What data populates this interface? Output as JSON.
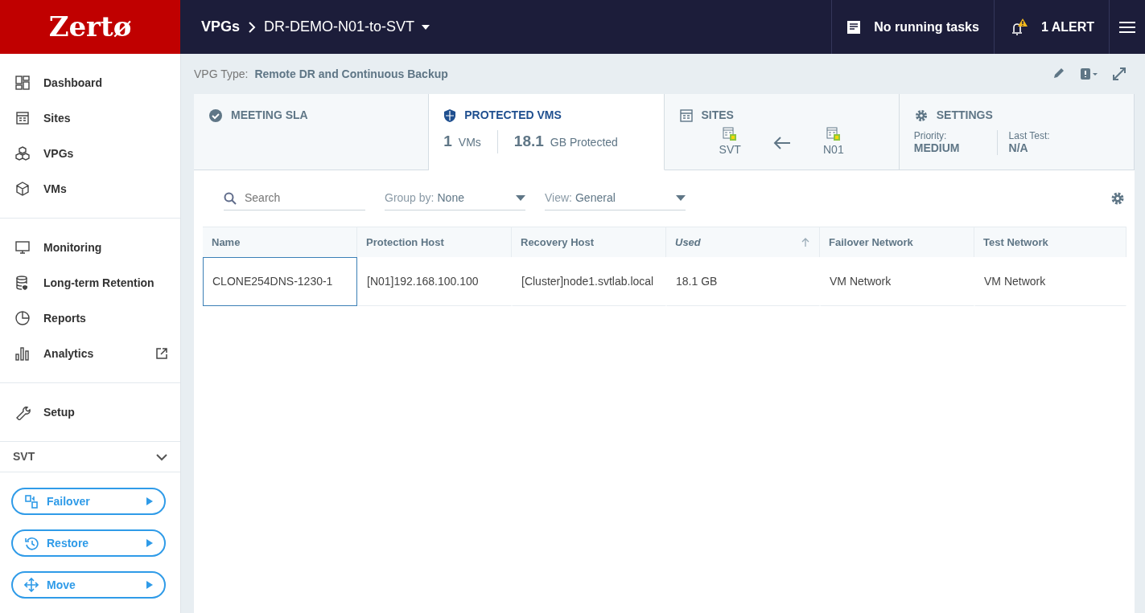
{
  "topbar": {
    "logo": "Zertø",
    "breadcrumb": [
      {
        "label": "VPGs"
      },
      {
        "label": "DR-DEMO-N01-to-SVT",
        "dropdown": true
      }
    ],
    "tasks": "No running tasks",
    "alerts": "1 ALERT"
  },
  "sidebar": {
    "groups": [
      {
        "items": [
          {
            "label": "Dashboard",
            "external": false
          },
          {
            "label": "Sites",
            "external": false
          },
          {
            "label": "VPGs",
            "external": false
          },
          {
            "label": "VMs",
            "external": false
          }
        ]
      },
      {
        "items": [
          {
            "label": "Monitoring",
            "external": false
          },
          {
            "label": "Long-term Retention",
            "external": false
          },
          {
            "label": "Reports",
            "external": false
          },
          {
            "label": "Analytics",
            "external": true
          }
        ]
      },
      {
        "items": [
          {
            "label": "Setup",
            "external": false
          }
        ]
      }
    ],
    "site": {
      "label": "SVT",
      "expanded": false
    },
    "actions": [
      {
        "label": "Failover"
      },
      {
        "label": "Restore"
      },
      {
        "label": "Move"
      }
    ]
  },
  "vpg_type": {
    "label": "VPG Type:",
    "value": "Remote DR and Continuous Backup"
  },
  "summary": [
    {
      "kind": "sla",
      "title": "MEETING SLA",
      "selected": false
    },
    {
      "kind": "protected",
      "title": "PROTECTED VMS",
      "selected": true,
      "stats": [
        {
          "value": "1",
          "unit": "VMs"
        },
        {
          "value": "18.1",
          "unit": "GB Protected"
        }
      ]
    },
    {
      "kind": "sites",
      "title": "SITES",
      "selected": false,
      "recovery": "SVT",
      "protected": "N01"
    },
    {
      "kind": "settings",
      "title": "SETTINGS",
      "selected": false,
      "fields": [
        {
          "label": "Priority:",
          "value": "MEDIUM"
        },
        {
          "label": "Last Test:",
          "value": "N/A"
        }
      ]
    }
  ],
  "toolbar": {
    "search": {
      "placeholder": "Search"
    },
    "group_by": {
      "label": "Group by:",
      "value": "None"
    },
    "view": {
      "label": "View:",
      "value": "General"
    }
  },
  "table": {
    "columns": [
      {
        "label": "Name",
        "sorted": false
      },
      {
        "label": "Protection Host",
        "sorted": false
      },
      {
        "label": "Recovery Host",
        "sorted": false
      },
      {
        "label": "Used",
        "sorted": true
      },
      {
        "label": "Failover Network",
        "sorted": false
      },
      {
        "label": "Test Network",
        "sorted": false
      }
    ],
    "rows": [
      {
        "focused": true,
        "cells": [
          "CLONE254DNS-1230-1",
          "[N01]192.168.100.100",
          "[Cluster]node1.svtlab.local",
          "18.1 GB",
          "VM Network",
          "VM Network"
        ]
      }
    ]
  }
}
